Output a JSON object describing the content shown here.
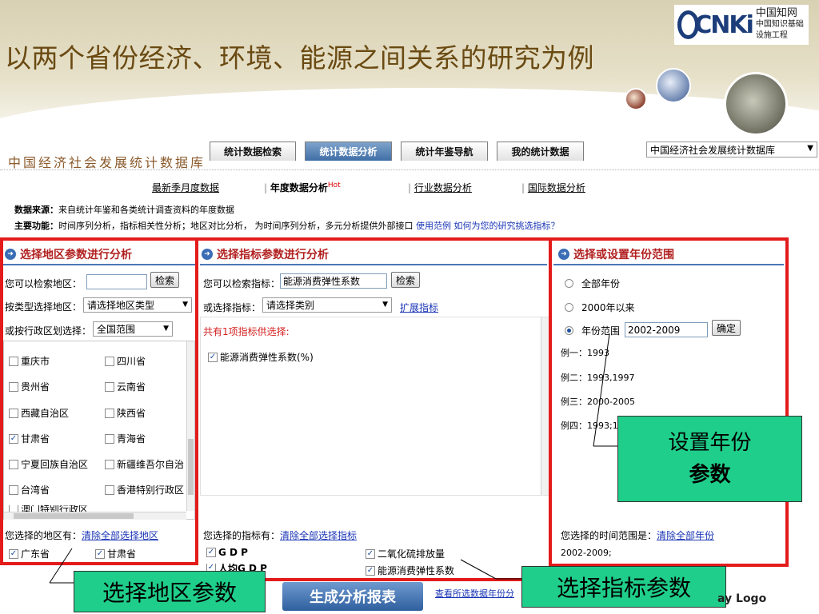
{
  "slide": {
    "title": "以两个省份经济、环境、能源之间关系的研究为例",
    "logo_mark": "CNKi",
    "logo_text_top": "中国知网",
    "logo_text_bottom": "中国知识基础设施工程"
  },
  "site": {
    "name": "中国经济社会发展统计数据库",
    "nav_tabs": [
      "统计数据检索",
      "统计数据分析",
      "统计年鉴导航",
      "我的统计数据"
    ],
    "db_select": "中国经济社会发展统计数据库",
    "subtabs": {
      "monthly": "最新季月度数据",
      "annual": "年度数据分析",
      "hot": "Hot",
      "industry": "行业数据分析",
      "international": "国际数据分析"
    },
    "source_label": "数据来源：",
    "source_text": "来自统计年鉴和各类统计调查资料的年度数据",
    "function_label": "主要功能：",
    "function_text": "时间序列分析，指标相关性分析；地区对比分析， 为时间序列分析，多元分析提供外部接口",
    "example_link": "使用范例",
    "howto_link": "如何为您的研究挑选指标？"
  },
  "region": {
    "title": "选择地区参数进行分析",
    "search_label": "您可以检索地区：",
    "search_btn": "检索",
    "type_label": "按类型选择地区：",
    "type_value": "请选择地区类型",
    "admin_label": "或按行政区划选择：",
    "admin_value": "全国范围",
    "items": [
      {
        "name": "重庆市",
        "checked": false
      },
      {
        "name": "四川省",
        "checked": false
      },
      {
        "name": "贵州省",
        "checked": false
      },
      {
        "name": "云南省",
        "checked": false
      },
      {
        "name": "西藏自治区",
        "checked": false
      },
      {
        "name": "陕西省",
        "checked": false
      },
      {
        "name": "甘肃省",
        "checked": true
      },
      {
        "name": "青海省",
        "checked": false
      },
      {
        "name": "宁夏回族自治区",
        "checked": false
      },
      {
        "name": "新疆维吾尔自治",
        "checked": false
      },
      {
        "name": "台湾省",
        "checked": false
      },
      {
        "name": "香港特别行政区",
        "checked": false
      },
      {
        "name": "澳门特别行政区",
        "checked": false
      }
    ],
    "selected_label": "您选择的地区有：",
    "clear_link": "清除全部选择地区",
    "selected": [
      "广东省",
      "甘肃省"
    ]
  },
  "indicator": {
    "title": "选择指标参数进行分析",
    "search_label": "您可以检索指标：",
    "search_value": "能源消费弹性系数",
    "search_btn": "检索",
    "category_label": "或选择指标：",
    "category_value": "请选择类别",
    "expand_link": "扩展指标",
    "count_text": "共有1项指标供选择:",
    "options": [
      {
        "name": "能源消费弹性系数(%)",
        "checked": true
      }
    ],
    "selected_label": "您选择的指标有：",
    "clear_link": "清除全部选择指标",
    "selected": [
      "G D P",
      "二氧化硫排放量",
      "人均G D P",
      "能源消费弹性系数"
    ]
  },
  "year": {
    "title": "选择或设置年份范围",
    "opt_all": "全部年份",
    "opt_since": "2000年以来",
    "opt_range": "年份范围",
    "range_value": "2002-2009",
    "confirm_btn": "确定",
    "examples": [
      "例一：1993",
      "例二：1993,1997",
      "例三：2000-2005",
      "例四：1993;19"
    ],
    "selected_label": "您选择的时间范围是：",
    "clear_link": "清除全部年份",
    "selected_value": "2002-2009;"
  },
  "callouts": {
    "year": [
      "设置年份",
      "参数"
    ],
    "region": "选择地区参数",
    "indicator": "选择指标参数"
  },
  "footer": {
    "generate_btn": "生成分析报表",
    "view_link": "查看所选数据年份分",
    "logo": "ay  Logo"
  }
}
